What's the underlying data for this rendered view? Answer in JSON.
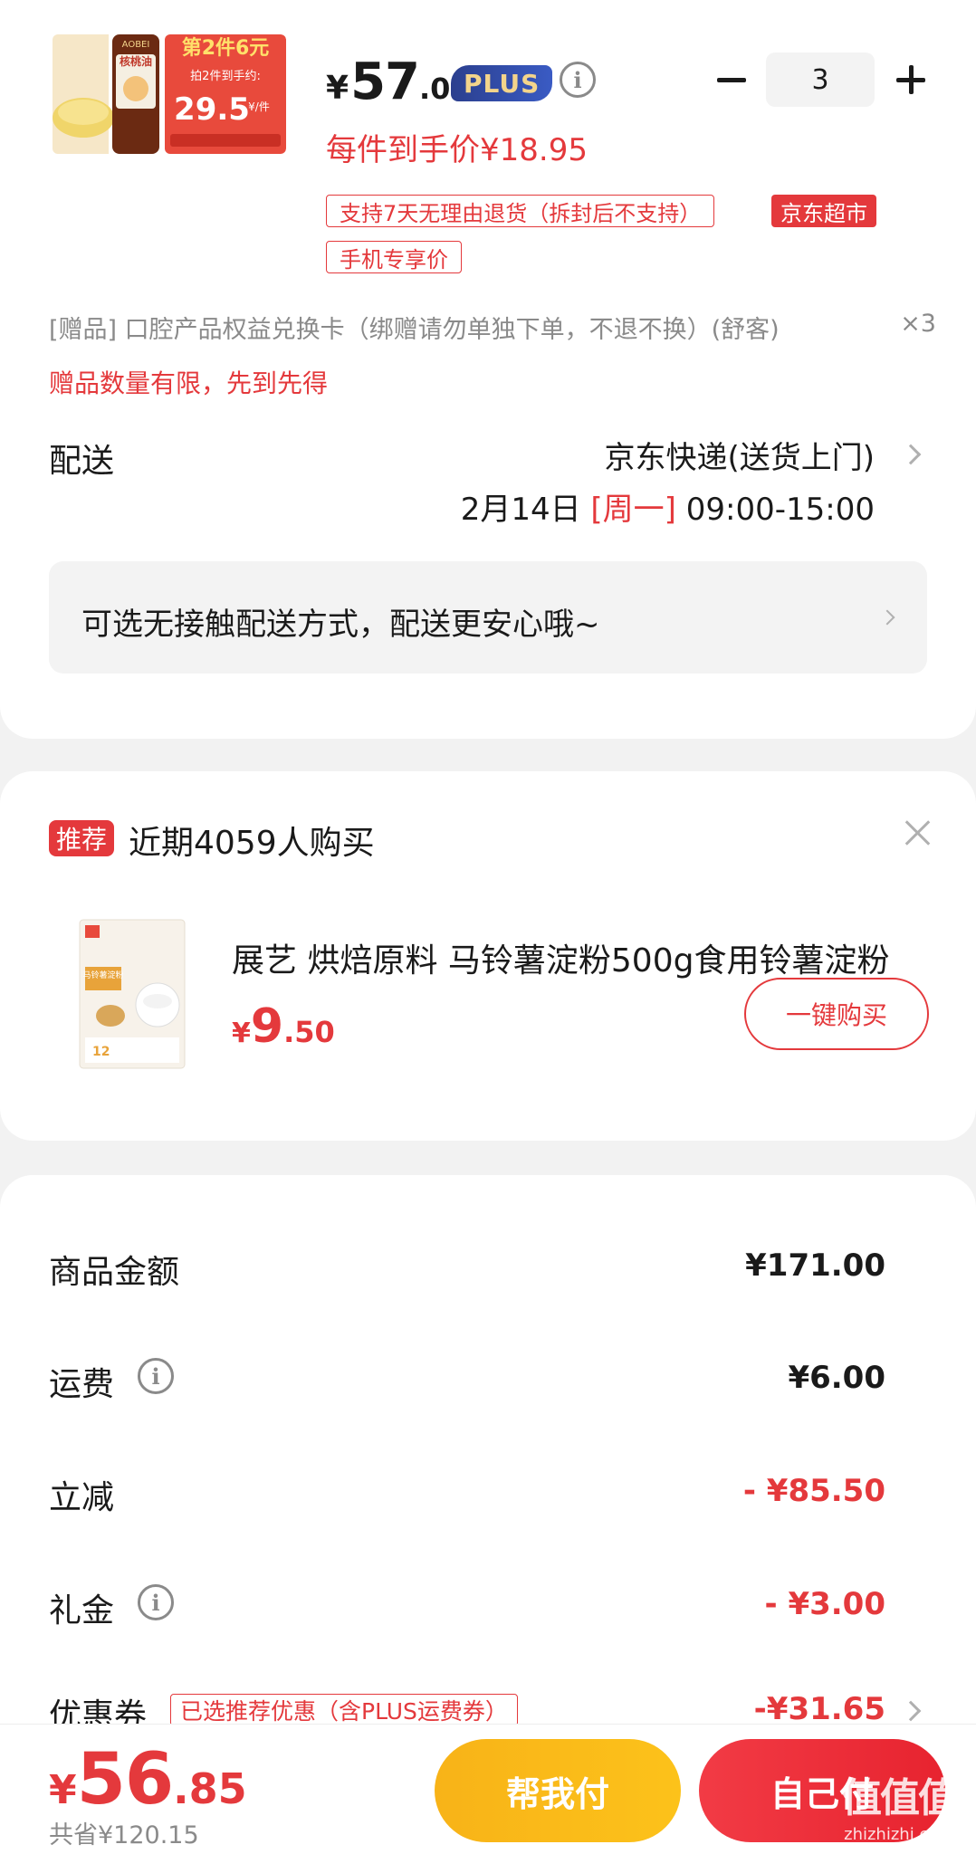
{
  "product": {
    "thumb_text_promo": "第2件6元",
    "thumb_text_brand": "核桃油",
    "thumb_text_label": "拍2件到手约:",
    "thumb_text_price": "29.5",
    "thumb_text_unit": "¥/件",
    "price_symbol": "¥",
    "price_int": "57",
    "price_dec": ".00",
    "plus_badge": "PLUS",
    "quantity": "3",
    "each_price": "每件到手价¥18.95",
    "tag_return": "支持7天无理由退货（拆封后不支持）",
    "tag_supermarket": "京东超市",
    "tag_mobile": "手机专享价",
    "gift_text": "[赠品]  口腔产品权益兑换卡（绑赠请勿单独下单，不退不换）(舒客)",
    "gift_qty": "×3",
    "gift_limit": "赠品数量有限，先到先得"
  },
  "delivery": {
    "label": "配送",
    "method": "京东快递(送货上门)",
    "date": "2月14日",
    "weekday": "[周一]",
    "time": "09:00-15:00",
    "contactless": "可选无接触配送方式，配送更安心哦~"
  },
  "recommend": {
    "badge": "推荐",
    "title": "近期4059人购买",
    "image_text": "马铃薯淀粉",
    "name": "展艺 烘焙原料 马铃薯淀粉500g食用铃薯淀粉",
    "price_symbol": "¥",
    "price_int": "9",
    "price_dec": ".50",
    "buy_label": "一键购买"
  },
  "summary": {
    "goods_label": "商品金额",
    "goods_value": "¥171.00",
    "shipping_label": "运费",
    "shipping_value": "¥6.00",
    "discount_label": "立减",
    "discount_value": "- ¥85.50",
    "giftcash_label": "礼金",
    "giftcash_value": "- ¥3.00",
    "coupon_label": "优惠券",
    "coupon_tag": "已选推荐优惠（含PLUS运费券）",
    "coupon_value": "-¥31.65"
  },
  "checkout": {
    "total_symbol": "¥",
    "total_int": "56",
    "total_dec": ".85",
    "saved": "共省¥120.15",
    "help_pay": "帮我付",
    "self_pay": "自己付",
    "watermark": "值值值",
    "watermark_url": "zhizhizhi.com"
  },
  "colors": {
    "accent_red": "#e4393c",
    "help_pay_yellow": "#fcc21a",
    "plus_blue": "#2b3f8e"
  }
}
